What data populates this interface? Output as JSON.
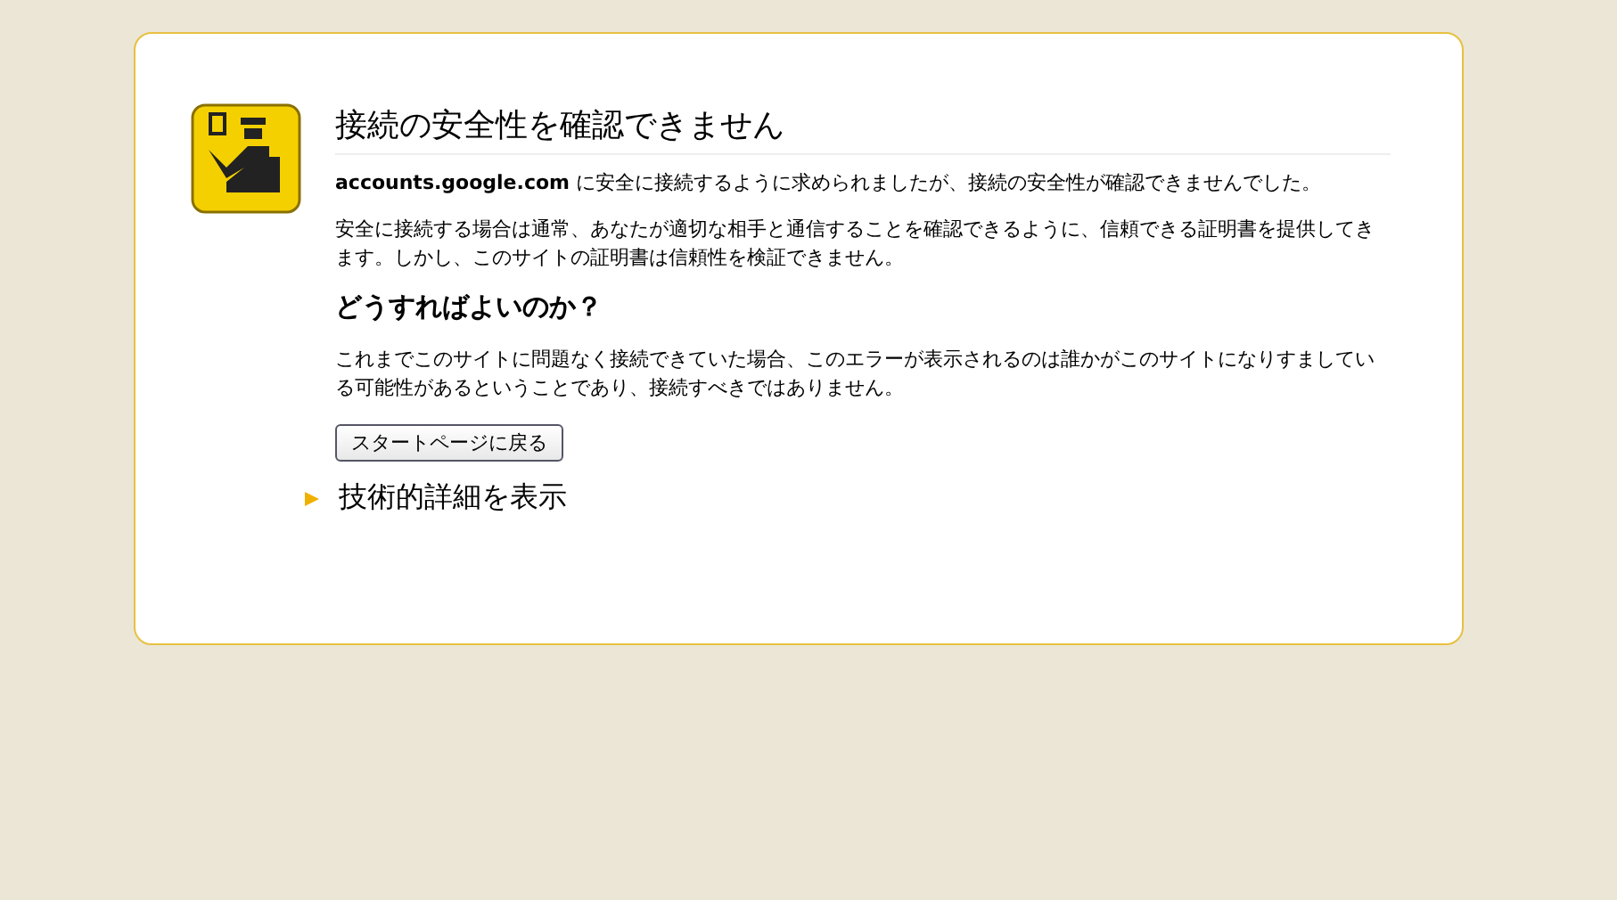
{
  "title": "接続の安全性を確認できません",
  "paragraphs": [
    "**accounts.google.com** に安全に接続するように求められましたが、接続の安全性が確認できませんでした。",
    "安全に接続する場合は通常、あなたが適切な相手と通信することを確認できるように、信頼できる証明書を提供してきます。しかし、このサイトの証明書は信頼性を検証できません。"
  ],
  "subheading": "どうすればよいのか？",
  "advice": "これまでこのサイトに問題なく接続できていた場合、このエラーが表示されるのは誰かがこのサイトになりすましている可能性があるということであり、接続すべきではありません。",
  "button": "スタートページに戻る",
  "details": {
    "label": "技術的詳細を表示",
    "expanded": false
  }
}
